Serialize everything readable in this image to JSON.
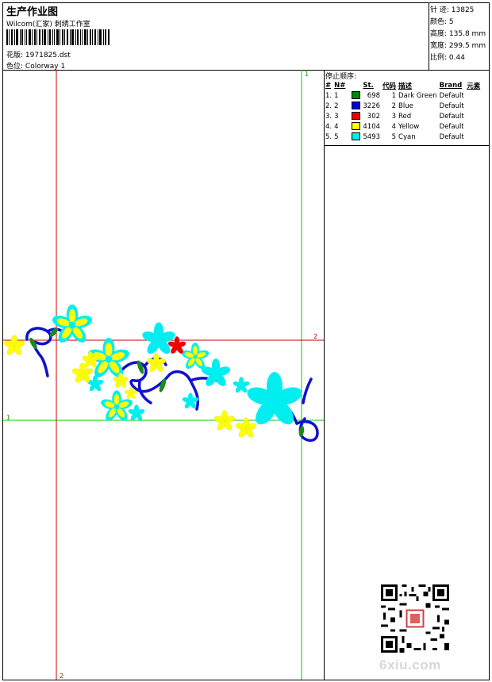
{
  "header": {
    "title": "生产作业图",
    "subtitle": "Wilcom(汇家) 刺绣工作室",
    "design_label": "花版:",
    "design_value": "1971825.dst",
    "colorway_label": "色位:",
    "colorway_value": "Colorway 1"
  },
  "stats": [
    {
      "label": "针 迹:",
      "value": "13825"
    },
    {
      "label": "颜色:",
      "value": "5"
    },
    {
      "label": "高度:",
      "value": "135.8 mm"
    },
    {
      "label": "宽度:",
      "value": "299.5 mm"
    },
    {
      "label": "比例:",
      "value": "0.44"
    }
  ],
  "stop_sequence": {
    "title": "停止顺序:",
    "columns": [
      "#",
      "N#",
      "St.",
      "代码",
      "描述",
      "Brand",
      "元素"
    ],
    "rows": [
      {
        "num": "1.",
        "n": "1",
        "color": "#008800",
        "stitches": "698",
        "code": "1",
        "desc": "Dark Green",
        "brand": "Default"
      },
      {
        "num": "2.",
        "n": "2",
        "color": "#0000dd",
        "stitches": "3226",
        "code": "2",
        "desc": "Blue",
        "brand": "Default"
      },
      {
        "num": "3.",
        "n": "3",
        "color": "#ee0000",
        "stitches": "302",
        "code": "3",
        "desc": "Red",
        "brand": "Default"
      },
      {
        "num": "4.",
        "n": "4",
        "color": "#ffff00",
        "stitches": "4104",
        "code": "4",
        "desc": "Yellow",
        "brand": "Default"
      },
      {
        "num": "5.",
        "n": "5",
        "color": "#00eeee",
        "stitches": "5493",
        "code": "5",
        "desc": "Cyan",
        "brand": "Default"
      }
    ]
  },
  "guides": {
    "green_top": "1",
    "green_left": "1",
    "red_right": "2",
    "red_bottom": "2"
  },
  "watermark": "6xiu.com",
  "colors": {
    "green_guide": "#00cc00",
    "red_guide": "#cc0000",
    "blue": "#1010d0",
    "cyan": "#00eef0",
    "yellow": "#ffff00",
    "red": "#ee0000",
    "dark_green": "#1a8a1a"
  }
}
